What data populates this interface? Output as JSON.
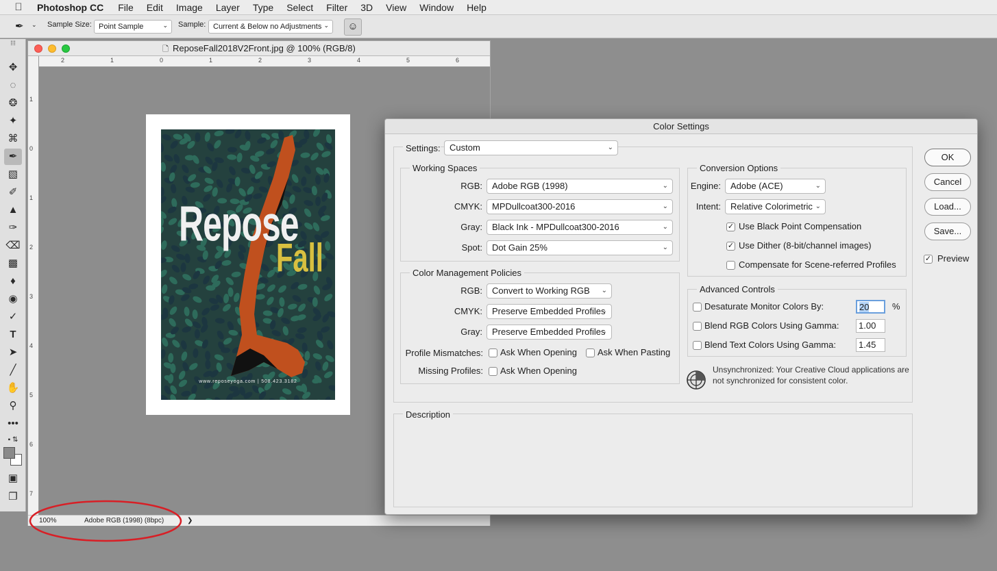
{
  "menubar": {
    "app_name": "Photoshop CC",
    "items": [
      "File",
      "Edit",
      "Image",
      "Layer",
      "Type",
      "Select",
      "Filter",
      "3D",
      "View",
      "Window",
      "Help"
    ]
  },
  "options_bar": {
    "sample_size_label": "Sample Size:",
    "sample_size_value": "Point Sample",
    "sample_label": "Sample:",
    "sample_value": "Current & Below no Adjustments"
  },
  "document": {
    "title": "ReposeFall2018V2Front.jpg @ 100% (RGB/8)",
    "ruler_h": [
      "2",
      "1",
      "0",
      "1",
      "2",
      "3",
      "4",
      "5",
      "6"
    ],
    "ruler_v": [
      "1",
      "0",
      "1",
      "2",
      "3",
      "4",
      "5",
      "6",
      "7"
    ],
    "poster": {
      "word1": "Repose",
      "word2": "Fall",
      "footer": "www.reposeyoga.com | 508.423.3182",
      "bg_color": "#24413e",
      "leaf_color": "#2e6b5b",
      "text_color": "#f0f0f0",
      "accent_color": "#d8c040",
      "figure_color": "#c0501e"
    },
    "status": {
      "zoom": "100%",
      "profile": "Adobe RGB (1998) (8bpc)"
    }
  },
  "dialog": {
    "title": "Color Settings",
    "settings_label": "Settings:",
    "settings_value": "Custom",
    "working_spaces": {
      "title": "Working Spaces",
      "rows": [
        {
          "label": "RGB:",
          "value": "Adobe RGB (1998)"
        },
        {
          "label": "CMYK:",
          "value": "MPDullcoat300-2016"
        },
        {
          "label": "Gray:",
          "value": "Black Ink - MPDullcoat300-2016"
        },
        {
          "label": "Spot:",
          "value": "Dot Gain 25%"
        }
      ]
    },
    "policies": {
      "title": "Color Management Policies",
      "rows": [
        {
          "label": "RGB:",
          "value": "Convert to Working RGB"
        },
        {
          "label": "CMYK:",
          "value": "Preserve Embedded Profiles"
        },
        {
          "label": "Gray:",
          "value": "Preserve Embedded Profiles"
        }
      ],
      "mismatch_label": "Profile Mismatches:",
      "ask_opening": "Ask When Opening",
      "ask_pasting": "Ask When Pasting",
      "missing_label": "Missing Profiles:",
      "missing_ask_opening": "Ask When Opening"
    },
    "conversion": {
      "title": "Conversion Options",
      "engine_label": "Engine:",
      "engine_value": "Adobe (ACE)",
      "intent_label": "Intent:",
      "intent_value": "Relative Colorimetric",
      "black_point": "Use Black Point Compensation",
      "dither": "Use Dither (8-bit/channel images)",
      "scene_referred": "Compensate for Scene-referred Profiles"
    },
    "advanced": {
      "title": "Advanced Controls",
      "desaturate_label": "Desaturate Monitor Colors By:",
      "desaturate_value": "20",
      "desaturate_unit": "%",
      "blend_rgb_label": "Blend RGB Colors Using Gamma:",
      "blend_rgb_value": "1.00",
      "blend_text_label": "Blend Text Colors Using Gamma:",
      "blend_text_value": "1.45"
    },
    "sync_message": "Unsynchronized: Your Creative Cloud applications are not synchronized for consistent color.",
    "description_title": "Description",
    "buttons": {
      "ok": "OK",
      "cancel": "Cancel",
      "load": "Load...",
      "save": "Save..."
    },
    "preview_label": "Preview"
  },
  "annotation_color": "#d81f26"
}
